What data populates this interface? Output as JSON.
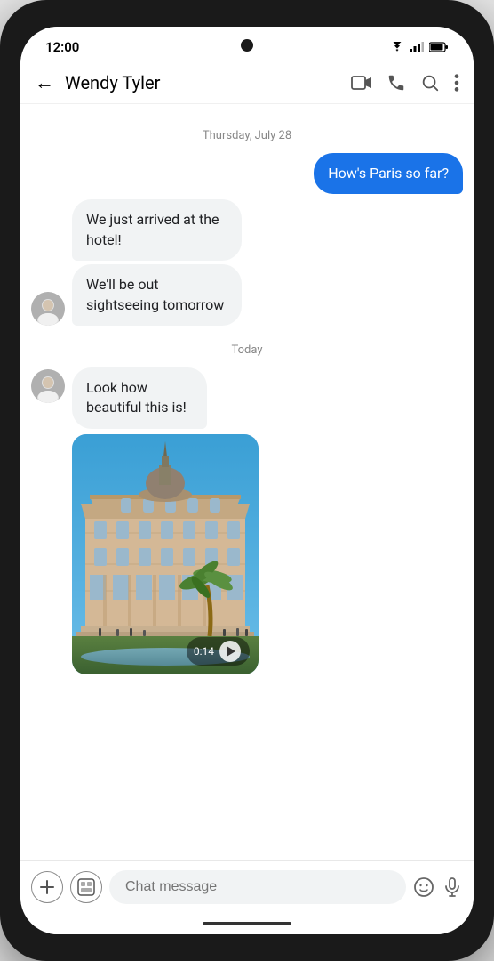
{
  "status_bar": {
    "time": "12:00",
    "wifi": "▲",
    "signal": "▲",
    "battery": "▮"
  },
  "header": {
    "back_label": "←",
    "contact_name": "Wendy Tyler",
    "video_icon": "video",
    "phone_icon": "phone",
    "search_icon": "search",
    "more_icon": "more"
  },
  "chat": {
    "date_separator_1": "Thursday, July 28",
    "date_separator_2": "Today",
    "messages": [
      {
        "type": "sent",
        "text": "How's Paris so far?"
      },
      {
        "type": "received",
        "text": "We just arrived at the hotel!"
      },
      {
        "type": "received",
        "text": "We'll be out sightseeing tomorrow"
      },
      {
        "type": "received",
        "text": "Look how beautiful this is!"
      },
      {
        "type": "received_media",
        "duration": "0:14"
      }
    ]
  },
  "bottom_bar": {
    "add_icon": "+",
    "sticker_icon": "⊞",
    "placeholder": "Chat message",
    "emoji_icon": "☺",
    "mic_icon": "🎤"
  }
}
